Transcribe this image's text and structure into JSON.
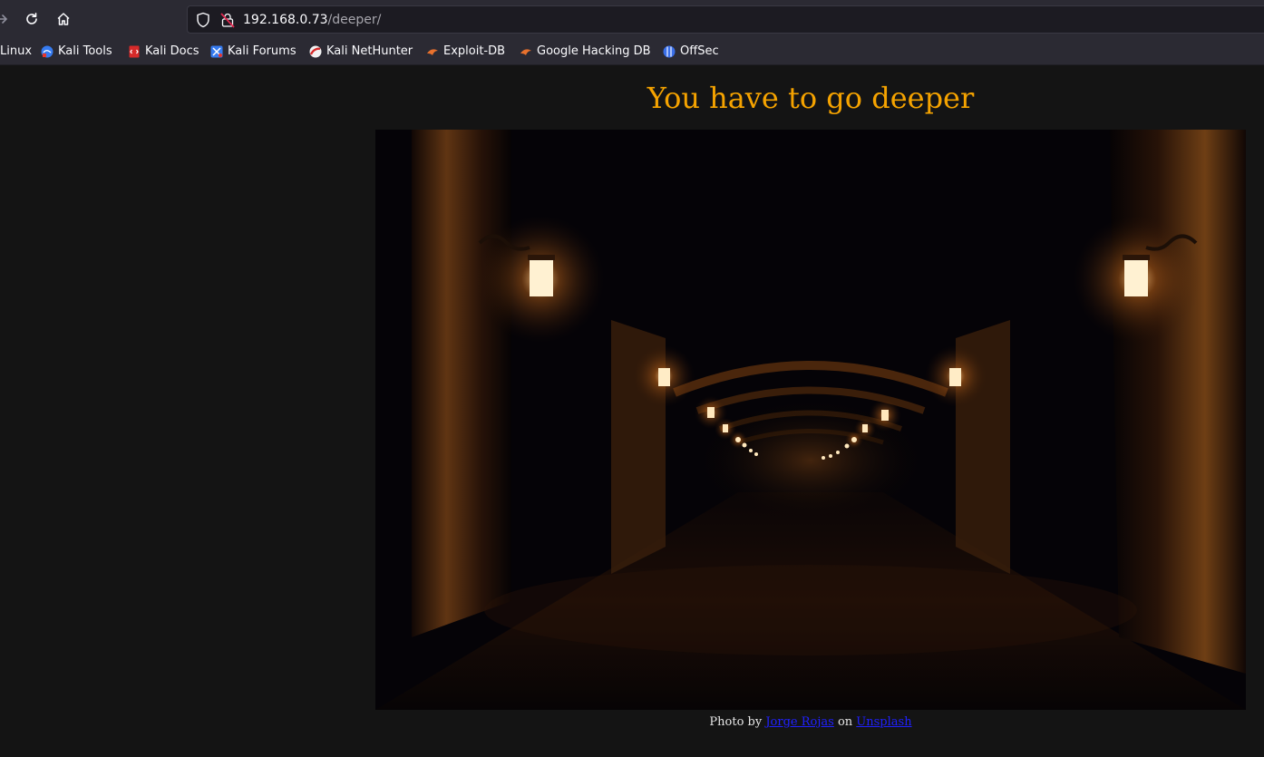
{
  "browser": {
    "url_host": "192.168.0.73",
    "url_path": "/deeper/",
    "bookmarks": [
      {
        "label": "Linux",
        "icon": "kali-linux-icon"
      },
      {
        "label": "Kali Tools",
        "icon": "kali-tools-icon"
      },
      {
        "label": "Kali Docs",
        "icon": "kali-docs-icon"
      },
      {
        "label": "Kali Forums",
        "icon": "kali-forums-icon"
      },
      {
        "label": "Kali NetHunter",
        "icon": "kali-nethunter-icon"
      },
      {
        "label": "Exploit-DB",
        "icon": "exploit-db-icon"
      },
      {
        "label": "Google Hacking DB",
        "icon": "google-hacking-db-icon"
      },
      {
        "label": "OffSec",
        "icon": "offsec-icon"
      }
    ]
  },
  "page": {
    "heading": "You have to go deeper",
    "credit": {
      "prefix": "Photo by",
      "author": "Jorge Rojas",
      "middle": "on",
      "site": "Unsplash"
    }
  },
  "colors": {
    "heading": "#f5a300",
    "link": "#2020ff",
    "page_bg": "#141414",
    "toolbar_bg": "#2b2a33"
  }
}
